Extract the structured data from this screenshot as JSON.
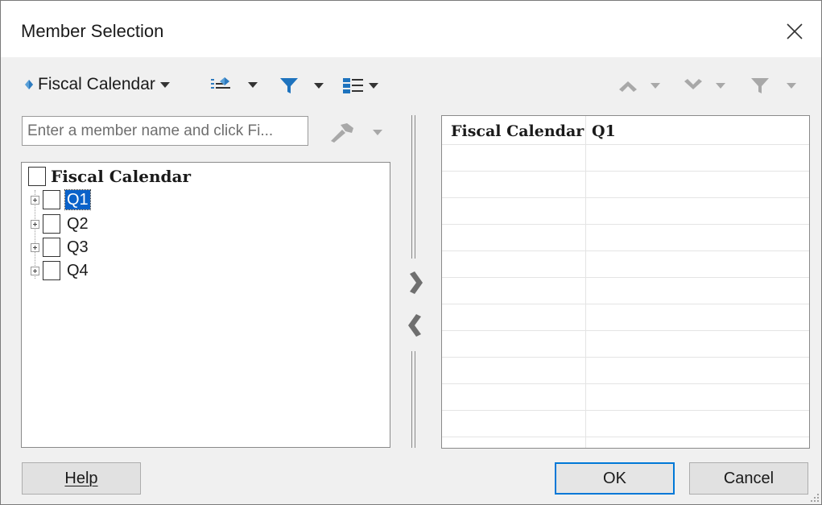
{
  "dialog": {
    "title": "Member Selection"
  },
  "toolbar": {
    "dimension_label": "Fiscal Calendar",
    "icons": [
      "member-display-icon",
      "filter-icon",
      "view-options-icon",
      "move-up-icon",
      "move-down-icon",
      "filter-selected-icon"
    ],
    "accent_color": "#1e73be"
  },
  "search": {
    "placeholder": "Enter a member name and click Fi...",
    "value": ""
  },
  "tree": {
    "root_label": "Fiscal Calendar",
    "items": [
      {
        "label": "Q1",
        "selected": true
      },
      {
        "label": "Q2",
        "selected": false
      },
      {
        "label": "Q3",
        "selected": false
      },
      {
        "label": "Q4",
        "selected": false
      }
    ]
  },
  "selection": {
    "columns": [
      "Fiscal Calendar",
      "Q1"
    ]
  },
  "buttons": {
    "help": "Help",
    "ok": "OK",
    "cancel": "Cancel"
  }
}
